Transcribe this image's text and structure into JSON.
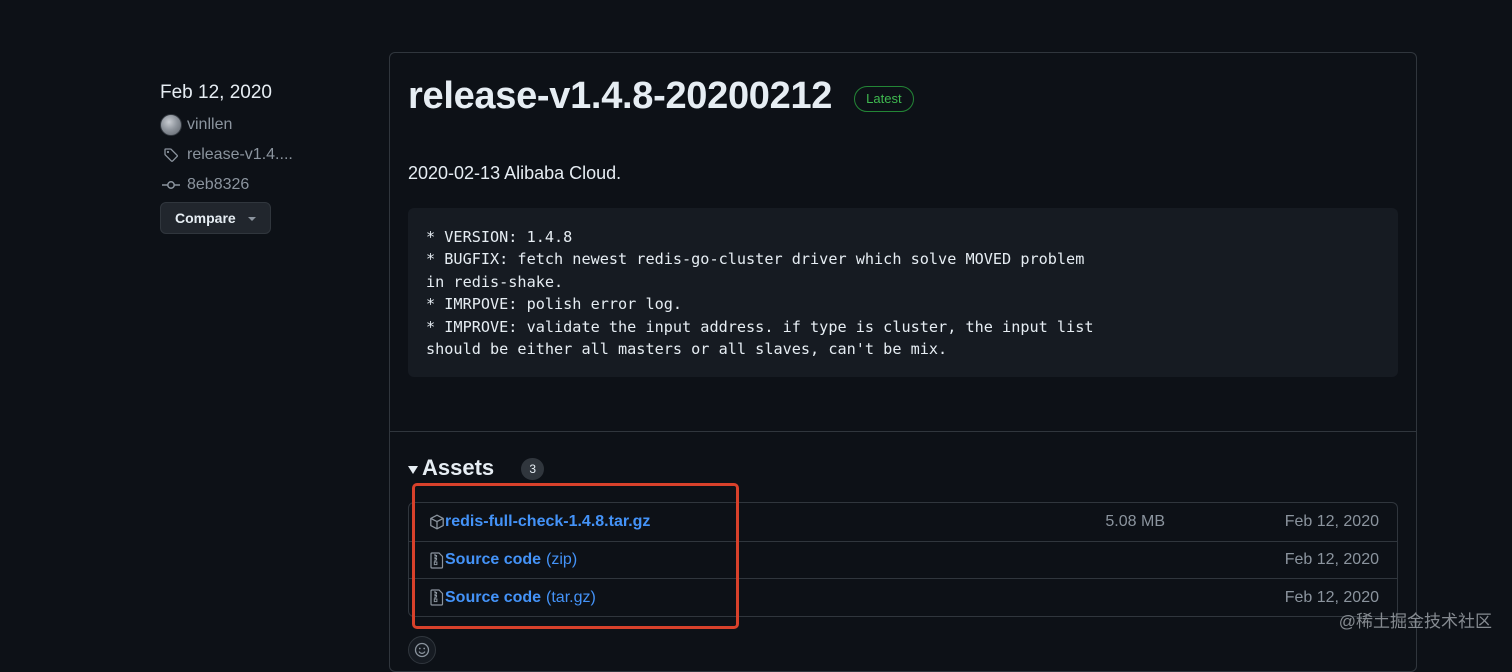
{
  "sidebar": {
    "date": "Feb 12, 2020",
    "author": "vinllen",
    "tag": "release-v1.4....",
    "commit": "8eb8326",
    "compare_label": "Compare"
  },
  "release": {
    "title": "release-v1.4.8-20200212",
    "badge": "Latest",
    "description": "2020-02-13 Alibaba Cloud.",
    "notes": "* VERSION: 1.4.8\n* BUGFIX: fetch newest redis-go-cluster driver which solve MOVED problem\nin redis-shake.\n* IMRPOVE: polish error log.\n* IMPROVE: validate the input address. if type is cluster, the input list\nshould be either all masters or all slaves, can't be mix."
  },
  "assets": {
    "title": "Assets",
    "count": "3",
    "items": [
      {
        "name": "redis-full-check-1.4.8.tar.gz",
        "suffix": "",
        "size": "5.08 MB",
        "date": "Feb 12, 2020",
        "icon": "package-icon"
      },
      {
        "name": "Source code",
        "suffix": "(zip)",
        "size": "",
        "date": "Feb 12, 2020",
        "icon": "file-zip-icon"
      },
      {
        "name": "Source code",
        "suffix": "(tar.gz)",
        "size": "",
        "date": "Feb 12, 2020",
        "icon": "file-zip-icon"
      }
    ]
  },
  "watermark": "@稀土掘金技术社区",
  "colors": {
    "background": "#0d1117",
    "border": "#30363d",
    "link": "#4493f8",
    "latest_green": "#3fb950",
    "highlight_red": "#d8412b"
  }
}
